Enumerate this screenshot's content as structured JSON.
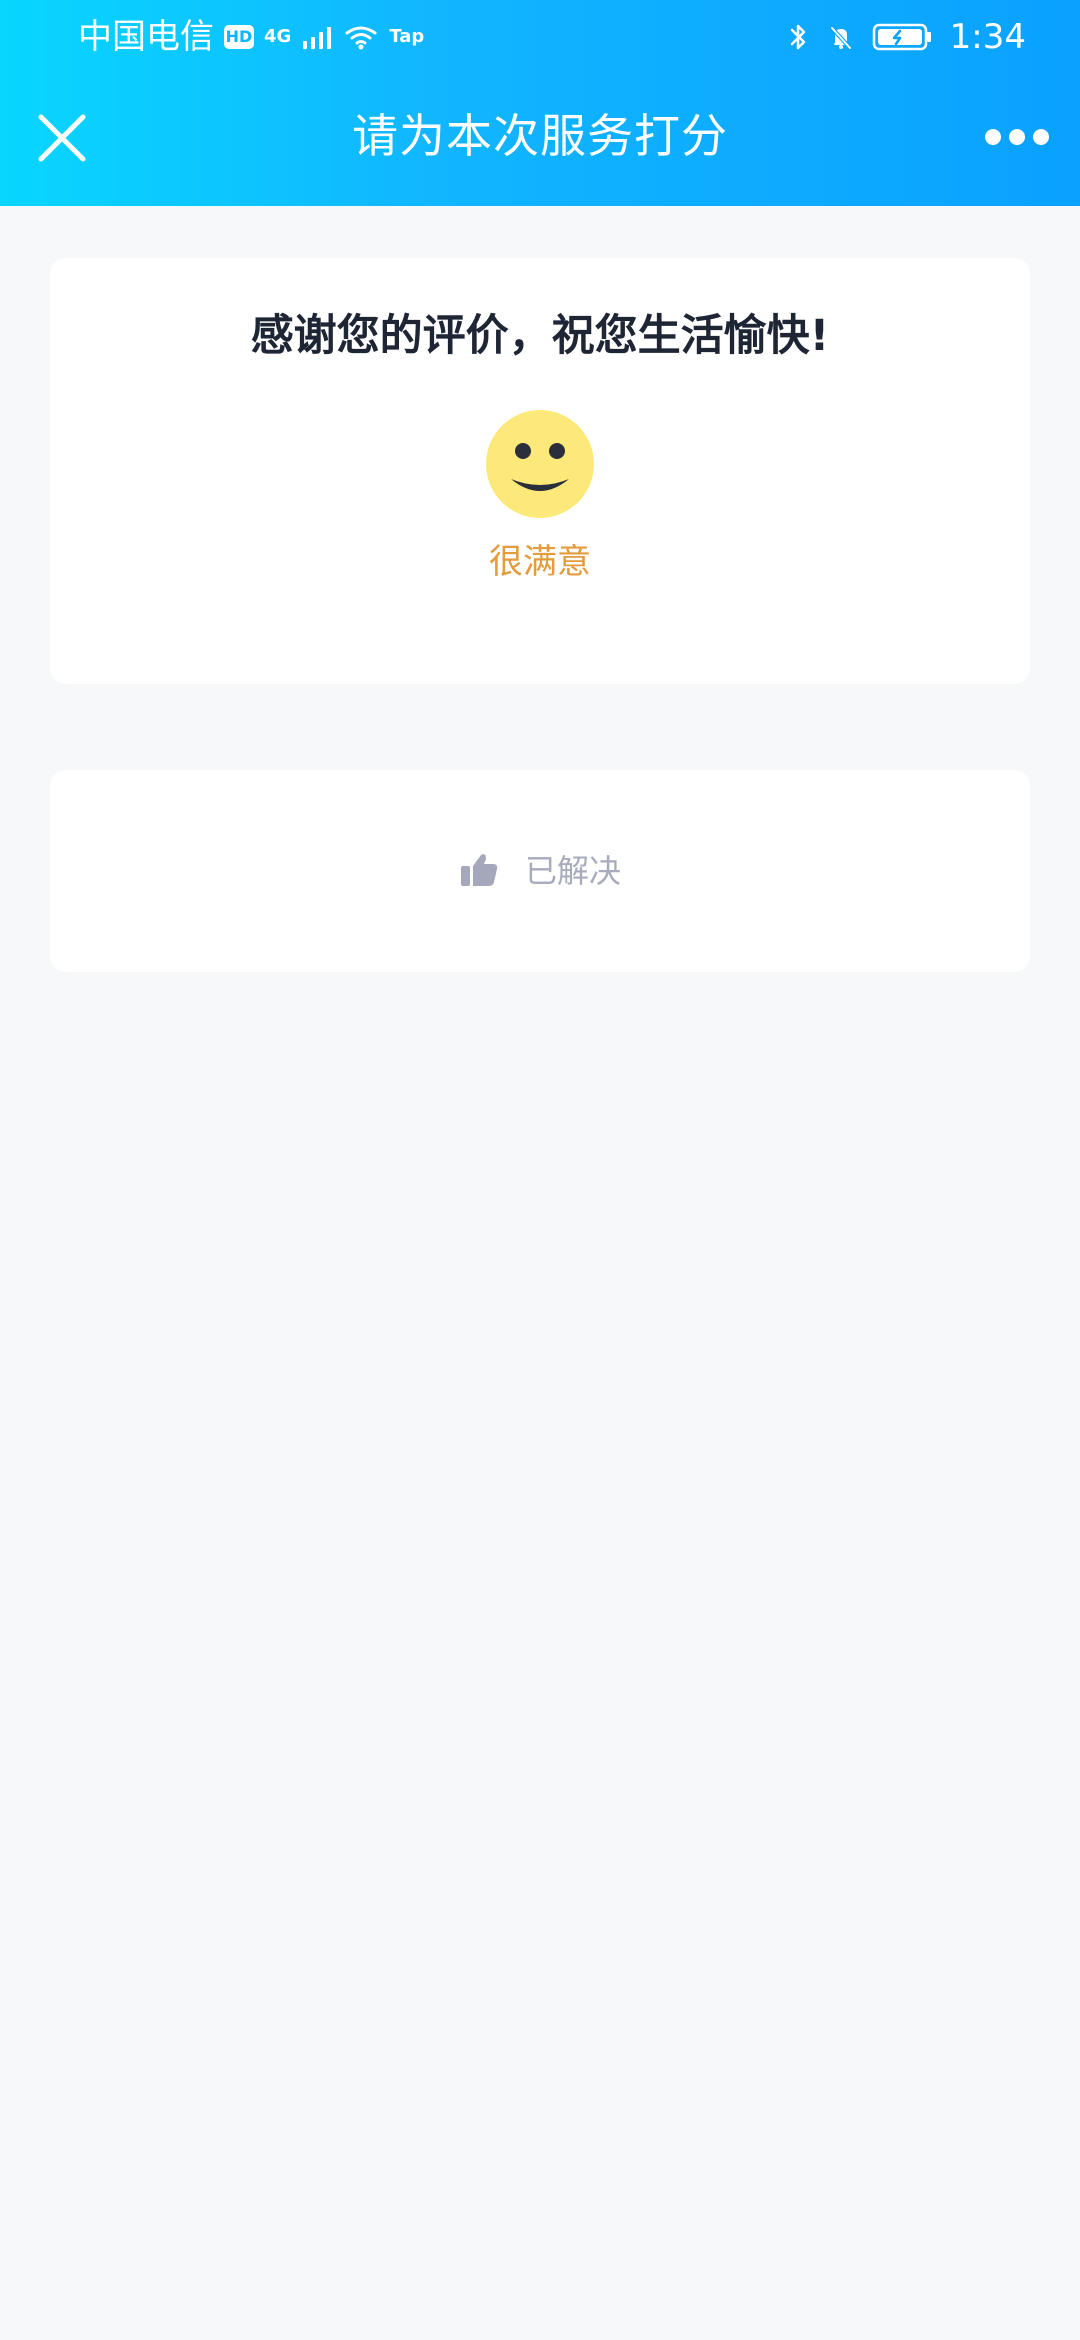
{
  "status_bar": {
    "carrier": "中国电信",
    "hd": "HD",
    "network": "4G",
    "extra": "Tap",
    "time": "1:34"
  },
  "nav": {
    "title": "请为本次服务打分"
  },
  "rating_card": {
    "message": "感谢您的评价，祝您生活愉快!",
    "rating_label": "很满意"
  },
  "result_card": {
    "label": "已解决"
  },
  "colors": {
    "header_gradient_start": "#08D6FF",
    "header_gradient_end": "#0AA1FF",
    "page_background": "#F7F8FA",
    "rating_text": "#E39B3B",
    "smiley_face": "#FDE97A",
    "result_icon": "#A4A8BA"
  }
}
